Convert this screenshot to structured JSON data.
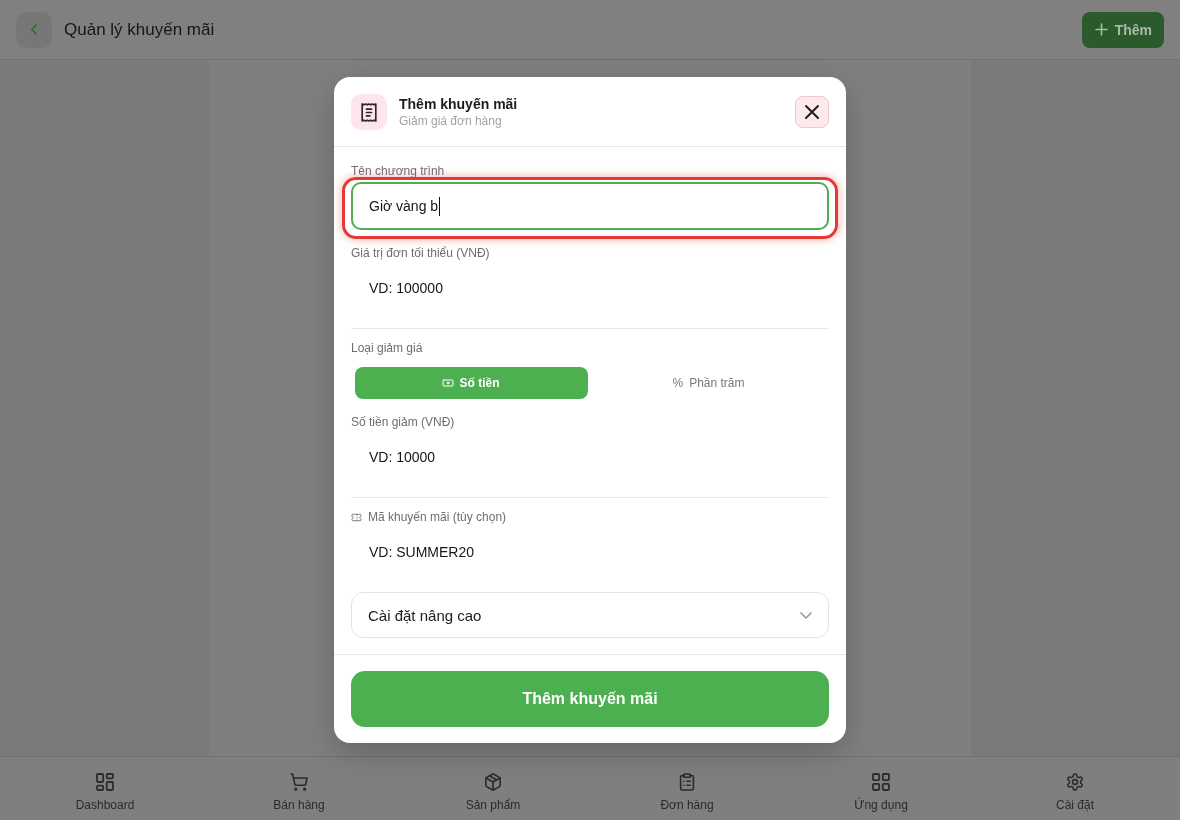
{
  "header": {
    "title": "Quản lý khuyến mãi",
    "add_label": "Thêm"
  },
  "dialog": {
    "title": "Thêm khuyến mãi",
    "subtitle": "Giảm giá đơn hàng",
    "groups": [
      {
        "fields": [
          {
            "kind": "text",
            "label": "Tên chương trình",
            "value": "Giờ vàng b",
            "focused": true,
            "highlighted": true
          },
          {
            "kind": "text",
            "label": "Giá trị đơn tối thiểu (VNĐ)",
            "placeholder": "VD: 100000",
            "focused": false,
            "highlighted": false
          }
        ]
      },
      {
        "fields": [
          {
            "kind": "choice",
            "label": "Loại giảm giá",
            "options": [
              {
                "kind": "amount",
                "label": "Số tiền",
                "selected": true
              },
              {
                "kind": "percent",
                "symbol": "%",
                "label": "Phần trăm",
                "selected": false
              }
            ]
          },
          {
            "kind": "text",
            "label": "Số tiền giảm (VNĐ)",
            "placeholder": "VD: 10000",
            "focused": false,
            "highlighted": false
          }
        ]
      },
      {
        "fields": [
          {
            "kind": "code",
            "label": "Mã khuyến mãi (tùy chọn)",
            "placeholder": "VD: SUMMER20",
            "focused": false,
            "highlighted": false
          }
        ]
      }
    ],
    "advanced": {
      "label": "Cài đặt nâng cao",
      "expanded": false
    },
    "submit_label": "Thêm khuyến mãi"
  },
  "nav": [
    {
      "label": "Dashboard"
    },
    {
      "label": "Bán hàng"
    },
    {
      "label": "Sản phẩm"
    },
    {
      "label": "Đơn hàng"
    },
    {
      "label": "Ứng dụng"
    },
    {
      "label": "Cài đặt"
    }
  ]
}
